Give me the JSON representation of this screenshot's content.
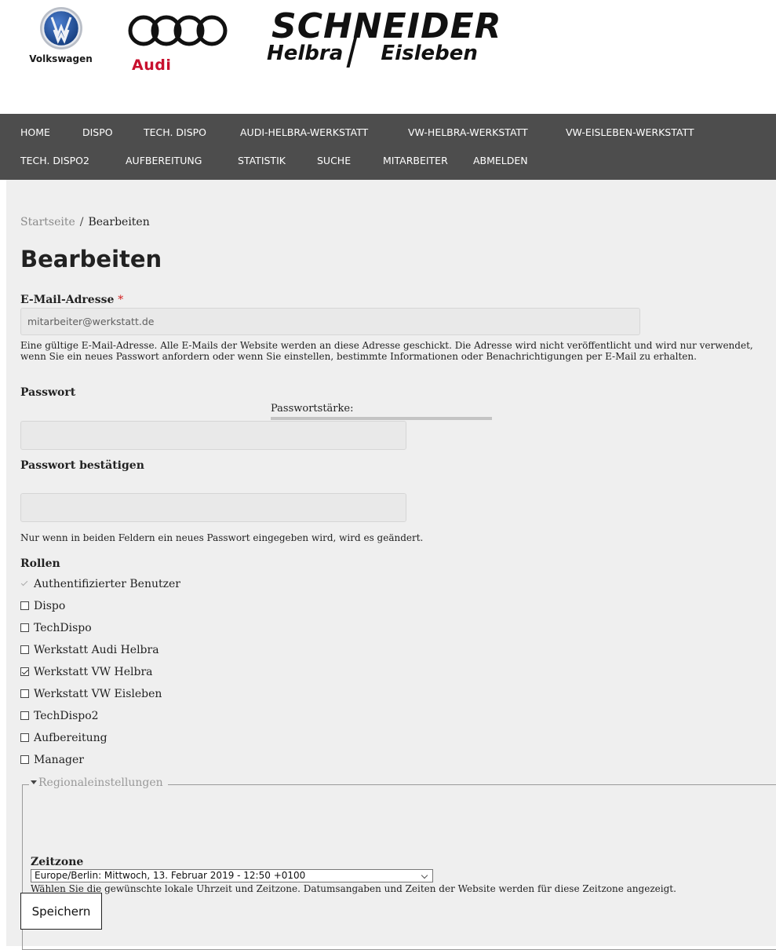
{
  "brands": {
    "vw": {
      "name": "Volkswagen",
      "color": "#1e4f9b"
    },
    "audi": {
      "name": "Audi",
      "color": "#c8102e"
    },
    "schneider": {
      "title": "SCHNEIDER",
      "left": "Helbra",
      "right": "Eisleben"
    }
  },
  "nav": {
    "row1": [
      "HOME",
      "DISPO",
      "TECH. DISPO",
      "AUDI-HELBRA-WERKSTATT",
      "VW-HELBRA-WERKSTATT",
      "VW-EISLEBEN-WERKSTATT"
    ],
    "row2": [
      "TECH. DISPO2",
      "AUFBEREITUNG",
      "STATISTIK",
      "SUCHE",
      "MITARBEITER",
      "ABMELDEN"
    ],
    "background": "#4d4d4d"
  },
  "breadcrumb": {
    "home": "Startseite",
    "separator": "/",
    "current": "Bearbeiten"
  },
  "page": {
    "title": "Bearbeiten"
  },
  "email": {
    "label": "E-Mail-Adresse",
    "required_mark": "*",
    "value": "mitarbeiter@werkstatt.de",
    "description": "Eine gültige E-Mail-Adresse. Alle E-Mails der Website werden an diese Adresse geschickt. Die Adresse wird nicht veröffentlicht und wird nur verwendet, wenn Sie ein neues Passwort anfordern oder wenn Sie einstellen, bestimmte Informationen oder Benachrichtigungen per E-Mail zu erhalten."
  },
  "password": {
    "label": "Passwort",
    "strength_label": "Passwortstärke:",
    "value": "",
    "confirm_label": "Passwort bestätigen",
    "confirm_value": "",
    "description": "Nur wenn in beiden Feldern ein neues Passwort eingegeben wird, wird es geändert."
  },
  "roles": {
    "label": "Rollen",
    "items": [
      {
        "label": "Authentifizierter Benutzer",
        "checked": true,
        "disabled": true
      },
      {
        "label": "Dispo",
        "checked": false
      },
      {
        "label": "TechDispo",
        "checked": false
      },
      {
        "label": "Werkstatt Audi Helbra",
        "checked": false
      },
      {
        "label": "Werkstatt VW Helbra",
        "checked": true
      },
      {
        "label": "Werkstatt VW Eisleben",
        "checked": false
      },
      {
        "label": "TechDispo2",
        "checked": false
      },
      {
        "label": "Aufbereitung",
        "checked": false
      },
      {
        "label": "Manager",
        "checked": false
      }
    ]
  },
  "regional": {
    "legend": "Regionaleinstellungen",
    "timezone_label": "Zeitzone",
    "timezone_value": "Europe/Berlin: Mittwoch, 13. Februar 2019 - 12:50 +0100",
    "timezone_description": "Wählen Sie die gewünschte lokale Uhrzeit und Zeitzone. Datumsangaben und Zeiten der Website werden für diese Zeitzone angezeigt."
  },
  "actions": {
    "save_label": "Speichern"
  }
}
